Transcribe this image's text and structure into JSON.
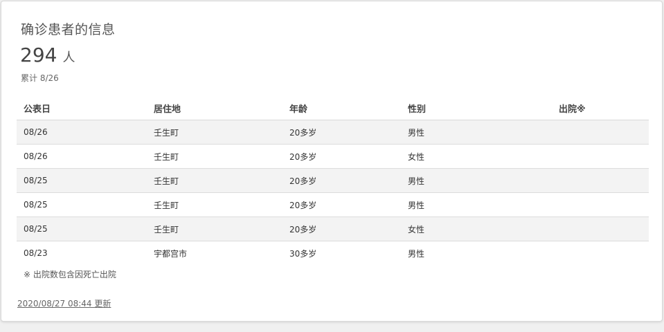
{
  "card": {
    "title": "确诊患者的信息",
    "count": "294",
    "count_unit": "人",
    "cumulative": "累计 8/26"
  },
  "table": {
    "headers": [
      "公表日",
      "居住地",
      "年龄",
      "性别",
      "出院※"
    ],
    "rows": [
      [
        "08/26",
        "壬生町",
        "20多岁",
        "男性",
        ""
      ],
      [
        "08/26",
        "壬生町",
        "20多岁",
        "女性",
        ""
      ],
      [
        "08/25",
        "壬生町",
        "20多岁",
        "男性",
        ""
      ],
      [
        "08/25",
        "壬生町",
        "20多岁",
        "男性",
        ""
      ],
      [
        "08/25",
        "壬生町",
        "20多岁",
        "女性",
        ""
      ],
      [
        "08/23",
        "宇都宫市",
        "30多岁",
        "男性",
        ""
      ]
    ]
  },
  "footer": {
    "note": "※ 出院数包含因死亡出院",
    "updated": "2020/08/27 08:44 更新"
  }
}
